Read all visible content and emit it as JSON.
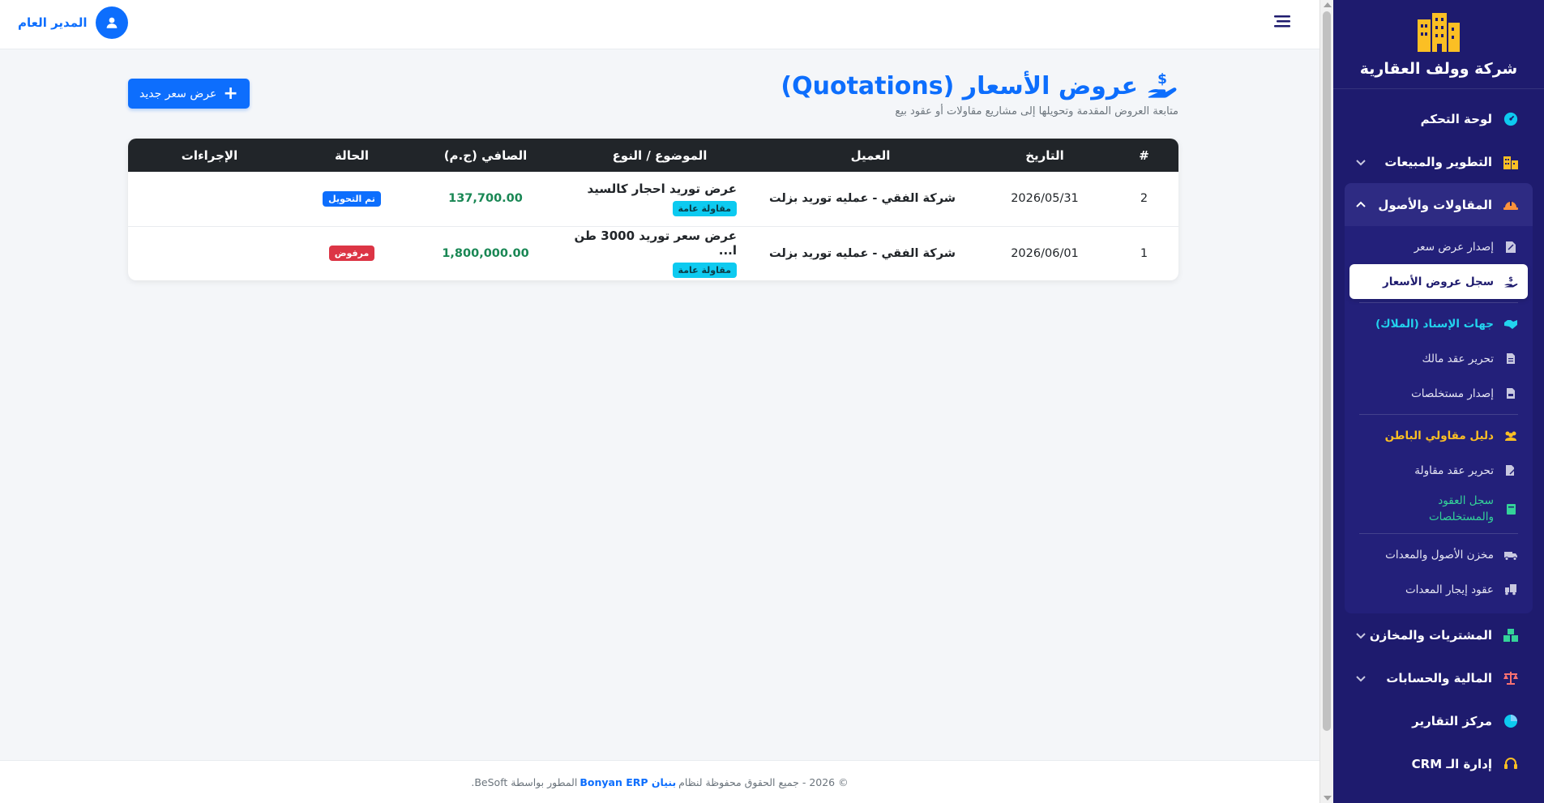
{
  "sidebar": {
    "brand_name": "شركة وولف العقارية",
    "items": [
      {
        "label": "لوحة التحكم",
        "icon": "gauge-icon",
        "icon_color": "#0dcaf0"
      },
      {
        "label": "التطوير والمبيعات",
        "icon": "building-icon",
        "icon_color": "#fbbf24"
      },
      {
        "label": "المقاولات والأصول",
        "icon": "helmet-icon",
        "icon_color": "#fb923c"
      },
      {
        "label": "المشتريات والمخازن",
        "icon": "boxes-icon",
        "icon_color": "#34d399"
      },
      {
        "label": "المالية والحسابات",
        "icon": "scale-icon",
        "icon_color": "#f87171"
      },
      {
        "label": "مركز التقارير",
        "icon": "pie-chart-icon",
        "icon_color": "#0dcaf0"
      },
      {
        "label": "إدارة الـ CRM",
        "icon": "headset-icon",
        "icon_color": "#fbbf24"
      }
    ],
    "sub_items": [
      {
        "label": "إصدار عرض سعر",
        "icon": "file-signature-icon"
      },
      {
        "label": "سجل عروض الأسعار",
        "icon": "hand-dollar-icon"
      },
      {
        "label": "جهات الإسناد (الملاك)",
        "icon": "handshake-icon"
      },
      {
        "label": "تحرير عقد مالك",
        "icon": "file-contract-icon"
      },
      {
        "label": "إصدار مستخلصات",
        "icon": "file-invoice-icon"
      },
      {
        "label": "دليل مقاولي الباطن",
        "icon": "users-icon"
      },
      {
        "label": "تحرير عقد مقاولة",
        "icon": "file-pen-icon"
      },
      {
        "label": "سجل العقود والمستخلصات",
        "icon": "book-icon"
      },
      {
        "label": "مخزن الأصول والمعدات",
        "icon": "truck-icon"
      },
      {
        "label": "عقود إيجار المعدات",
        "icon": "truck-ramp-icon"
      }
    ]
  },
  "topbar": {
    "user_name": "المدير العام"
  },
  "page": {
    "title": "عروض الأسعار (Quotations)",
    "subtitle": "متابعة العروض المقدمة وتحويلها إلى مشاريع مقاولات أو عقود بيع",
    "new_button": "عرض سعر جديد",
    "new_button_icon": "plus-icon"
  },
  "table": {
    "headers": {
      "num": "#",
      "date": "التاريخ",
      "client": "العميل",
      "subject": "الموضوع / النوع",
      "net": "الصافي (ج.م)",
      "status": "الحالة",
      "actions": "الإجراءات"
    },
    "rows": [
      {
        "num": "2",
        "date": "2026/05/31",
        "client": "شركة الفقي - عمليه توريد بزلت",
        "subject": "عرض توريد احجار كالسيد",
        "type": "مقاولة عامة",
        "net": "137,700.00",
        "status": "تم التحويل",
        "status_color": "#0d6efd"
      },
      {
        "num": "1",
        "date": "2026/06/01",
        "client": "شركة الفقي - عمليه توريد بزلت",
        "subject": "عرض سعر توريد 3000 طن ا...",
        "type": "مقاولة عامة",
        "net": "1,800,000.00",
        "status": "مرفوض",
        "status_color": "#dc3545"
      }
    ]
  },
  "footer": {
    "prefix": "© 2026 - جميع الحقوق محفوظة لنظام",
    "brand": "بنيان Bonyan ERP",
    "suffix": "المطور بواسطة BeSoft."
  },
  "colors": {
    "primary": "#0d6efd",
    "sidebar_bg": "#1e1b6e",
    "success": "#198754",
    "danger": "#dc3545",
    "info": "#0dcaf0"
  }
}
